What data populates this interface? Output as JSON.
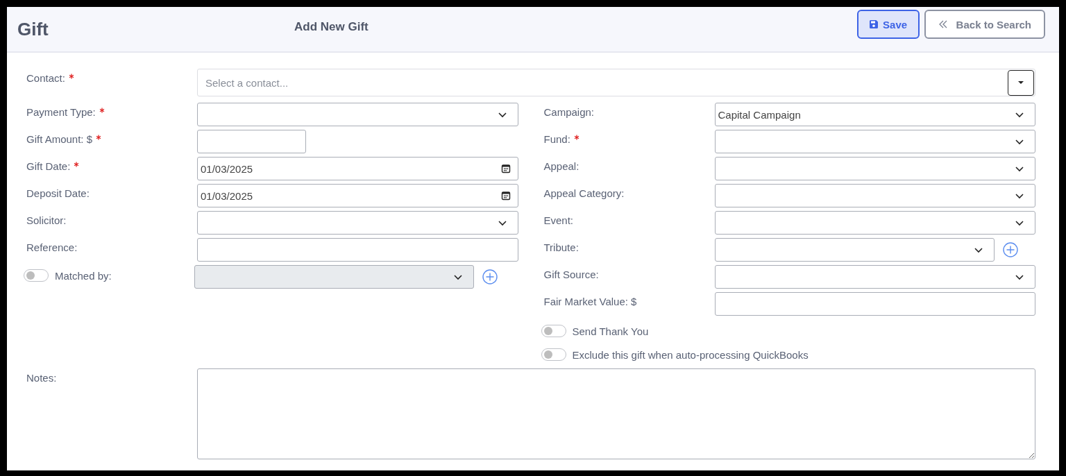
{
  "header": {
    "title": "Gift",
    "subtitle": "Add New Gift",
    "buttons": [
      {
        "label": "Save",
        "kind": "primary"
      },
      {
        "label": "Back to Search",
        "kind": "back"
      }
    ]
  },
  "contact": {
    "label": "Contact:",
    "required": true,
    "placeholder": "Select a contact..."
  },
  "left_fields": [
    {
      "label": "Payment Type:",
      "required": true,
      "kind": "select"
    },
    {
      "label": "Gift Amount: $",
      "required": true,
      "kind": "amount"
    },
    {
      "label": "Gift Date:",
      "required": true,
      "kind": "date",
      "value": "01/03/2025"
    },
    {
      "label": "Deposit Date:",
      "required": false,
      "kind": "date",
      "value": "01/03/2025"
    },
    {
      "label": "Solicitor:",
      "required": false,
      "kind": "select"
    },
    {
      "label": "Reference:",
      "required": false,
      "kind": "text"
    },
    {
      "label": "Matched by:",
      "required": false,
      "kind": "select",
      "toggle": {
        "on": false
      },
      "disabled": true,
      "add_button": true
    }
  ],
  "right_fields": [
    {
      "label": "Campaign:",
      "required": false,
      "kind": "select",
      "value": "Capital Campaign"
    },
    {
      "label": "Fund:",
      "required": true,
      "kind": "select"
    },
    {
      "label": "Appeal:",
      "required": false,
      "kind": "select"
    },
    {
      "label": "Appeal Category:",
      "required": false,
      "kind": "select"
    },
    {
      "label": "Event:",
      "required": false,
      "kind": "select"
    },
    {
      "label": "Tribute:",
      "required": false,
      "kind": "select",
      "add_button": true
    },
    {
      "label": "Gift Source:",
      "required": false,
      "kind": "select"
    },
    {
      "label": "Fair Market Value: $",
      "required": false,
      "kind": "text"
    }
  ],
  "toggles": [
    {
      "label": "Send Thank You",
      "on": false
    },
    {
      "label": "Exclude this gift when auto-processing QuickBooks",
      "on": false
    }
  ],
  "notes": {
    "label": "Notes:"
  }
}
